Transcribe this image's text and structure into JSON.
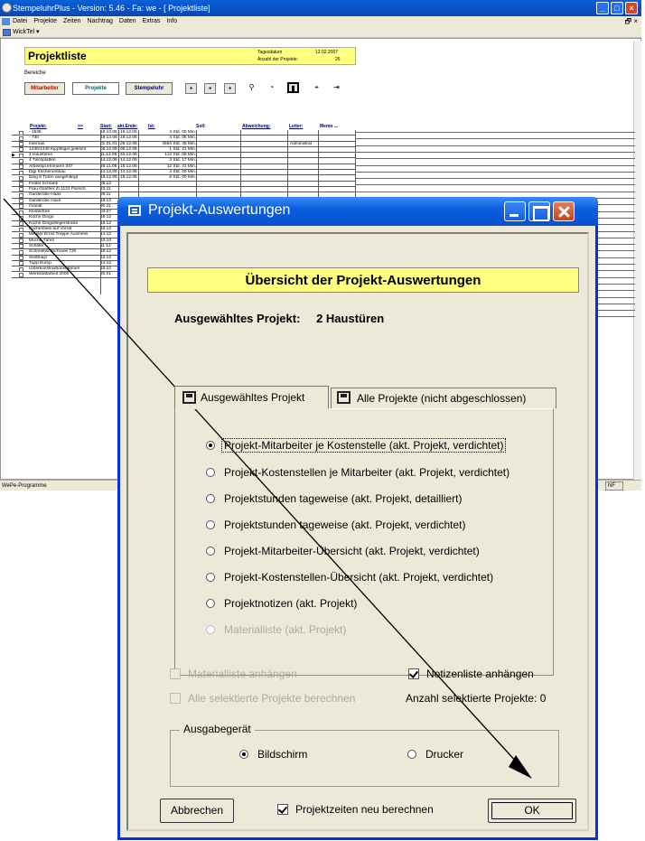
{
  "window": {
    "title": "StempeluhrPlus  -  Version: 5.46  -  Fa: we  - [ Projektliste]",
    "menu": [
      "Datei",
      "Projekte",
      "Zeiten",
      "Nachtrag",
      "Daten",
      "Extras",
      "Info"
    ],
    "toolbar_label": "WickTel ▾",
    "status_left": "WePe-Programme",
    "status_right": "NF"
  },
  "projektliste": {
    "title": "Projektliste",
    "tagesdatum_label": "Tagesdatum",
    "tagesdatum": "12.02.2007",
    "anzahl_label": "Anzahl der Projekte:",
    "anzahl": "26",
    "bereiche": "Bereiche",
    "btn_mitarbeiter": "Mitarbeiter",
    "btn_projekte": "Projekte",
    "btn_stempeluhr": "Stempeluhr",
    "columns": [
      "Projekt:",
      ">>",
      "Start:",
      "akt.Ende:",
      "Ist:",
      "Soll:",
      "Abweichung:",
      "Leiter:",
      "Memo ..."
    ],
    "rows": [
      {
        "name": "- 1538",
        "start": "18.12.06",
        "end": "18.12.06",
        "ist": "3 Std. 00 Min.",
        "leiter": ""
      },
      {
        "name": "- 730",
        "start": "18.12.06",
        "end": "19.12.06",
        "ist": "4 Std. 05 Min.",
        "leiter": ""
      },
      {
        "name": "Internas",
        "start": "01.01.01",
        "end": "26.12.06",
        "ist": "4564 Std. 48 Min.",
        "leiter": "Administrat"
      },
      {
        "name": "1430/1440 Kippflügel gelesmt",
        "start": "06.12.06",
        "end": "06.12.06",
        "ist": "1 Std. 21 Min.",
        "leiter": ""
      },
      {
        "name": "2 Haustüren",
        "start": "11.12.06",
        "end": "20.12.06",
        "ist": "113 Std. 05 Min.",
        "leiter": ""
      },
      {
        "name": "4 Tischplatten",
        "start": "14.12.06",
        "end": "14.12.06",
        "ist": "3 Std. 17 Min.",
        "leiter": ""
      },
      {
        "name": "Arbeitspl.erneuern 347",
        "start": "28.11.06",
        "end": "18.12.06",
        "ist": "12 Std. 41 Min.",
        "leiter": ""
      },
      {
        "name": "Digi Küchenumbau",
        "start": "14.12.06",
        "end": "14.12.06",
        "ist": "4 Std. 00 Min.",
        "leiter": ""
      },
      {
        "name": "Ding 6 Türen ausgehängt",
        "start": "18.12.06",
        "end": "18.12.06",
        "ist": "6 Std. 00 Min.",
        "leiter": ""
      },
      {
        "name": "Feldel Schrank",
        "start": "05.12",
        "end": "",
        "ist": "",
        "leiter": ""
      },
      {
        "name": "Frau Günther Zi.1131 Flursch",
        "start": "23.11",
        "end": "",
        "ist": "",
        "leiter": ""
      },
      {
        "name": "Garderobe Haas",
        "start": "28.11",
        "end": "",
        "ist": "",
        "leiter": ""
      },
      {
        "name": "Garderobe Haxe",
        "start": "18.12",
        "end": "",
        "ist": "",
        "leiter": ""
      },
      {
        "name": "Grandl",
        "start": "30.11",
        "end": "",
        "ist": "",
        "leiter": ""
      },
      {
        "name": "Klostertüre",
        "start": "03.07",
        "end": "",
        "ist": "",
        "leiter": ""
      },
      {
        "name": "Küche   Dingo",
        "start": "19.12",
        "end": "",
        "ist": "",
        "leiter": ""
      },
      {
        "name": "Küche Dingolfingerstraße",
        "start": "18.12",
        "end": "",
        "ist": "",
        "leiter": ""
      },
      {
        "name": "Küchenteile auf Vorrat",
        "start": "19.12",
        "end": "",
        "ist": "",
        "leiter": ""
      },
      {
        "name": "Meister Ernst Treppe Ausmess",
        "start": "14.12",
        "end": "",
        "ist": "",
        "leiter": ""
      },
      {
        "name": "Muche Türen",
        "start": "23.10",
        "end": "",
        "ist": "",
        "leiter": ""
      },
      {
        "name": "Schäfer",
        "start": "11.12",
        "end": "",
        "ist": "",
        "leiter": ""
      },
      {
        "name": "Schreibtischschrank 730",
        "start": "19.12",
        "end": "",
        "ist": "",
        "leiter": ""
      },
      {
        "name": "Sedlmayr",
        "start": "12.12",
        "end": "",
        "ist": "",
        "leiter": ""
      },
      {
        "name": "Tupp Europ",
        "start": "14.12",
        "end": "",
        "ist": "",
        "leiter": ""
      },
      {
        "name": "Unterkonstruktionsrahmen",
        "start": "18.12",
        "end": "",
        "ist": "",
        "leiter": ""
      },
      {
        "name": "Werkstattarbeit 2006",
        "start": "30.01",
        "end": "",
        "ist": "",
        "leiter": ""
      }
    ]
  },
  "dialog": {
    "title": "Projekt-Auswertungen",
    "header": "Übersicht der Projekt-Auswertungen",
    "selected_label": "Ausgewähltes Projekt:",
    "selected_value": "2 Haustüren",
    "tab_active": "Ausgewähltes Projekt",
    "tab_inactive": "Alle Projekte (nicht abgeschlossen)",
    "options": [
      "Projekt-Mitarbeiter je Kostenstelle (akt. Projekt, verdichtet)",
      "Projekt-Kostenstellen je Mitarbeiter (akt. Projekt, verdichtet)",
      "Projektstunden tageweise (akt. Projekt, detailliert)",
      "Projektstunden tageweise (akt. Projekt, verdichtet)",
      "Projekt-Mitarbeiter-Übersicht (akt. Projekt, verdichtet)",
      "Projekt-Kostenstellen-Übersicht (akt. Projekt, verdichtet)",
      "Projektnotizen (akt. Projekt)",
      "Materialliste (akt. Projekt)"
    ],
    "chk_material": "Materialliste anhängen",
    "chk_notizen": "Notizenliste anhängen",
    "chk_alle": "Alle selektierte Projekte berechnen",
    "anzahl_selektiert": "Anzahl selektierte Projekte: 0",
    "group_label": "Ausgabegerät",
    "radio_bildschirm": "Bildschirm",
    "radio_drucker": "Drucker",
    "btn_abbrechen": "Abbrechen",
    "chk_neu": "Projektzeiten neu berechnen",
    "btn_ok": "OK"
  }
}
